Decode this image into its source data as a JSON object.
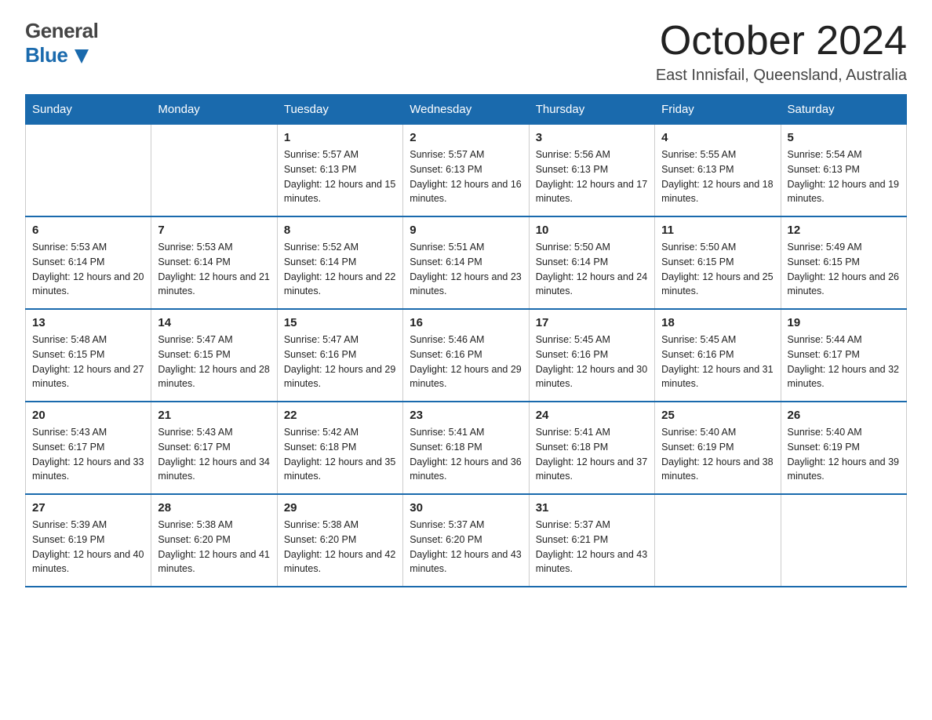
{
  "logo": {
    "general": "General",
    "blue": "Blue"
  },
  "header": {
    "month": "October 2024",
    "location": "East Innisfail, Queensland, Australia"
  },
  "weekdays": [
    "Sunday",
    "Monday",
    "Tuesday",
    "Wednesday",
    "Thursday",
    "Friday",
    "Saturday"
  ],
  "weeks": [
    [
      {
        "day": "",
        "sunrise": "",
        "sunset": "",
        "daylight": ""
      },
      {
        "day": "",
        "sunrise": "",
        "sunset": "",
        "daylight": ""
      },
      {
        "day": "1",
        "sunrise": "Sunrise: 5:57 AM",
        "sunset": "Sunset: 6:13 PM",
        "daylight": "Daylight: 12 hours and 15 minutes."
      },
      {
        "day": "2",
        "sunrise": "Sunrise: 5:57 AM",
        "sunset": "Sunset: 6:13 PM",
        "daylight": "Daylight: 12 hours and 16 minutes."
      },
      {
        "day": "3",
        "sunrise": "Sunrise: 5:56 AM",
        "sunset": "Sunset: 6:13 PM",
        "daylight": "Daylight: 12 hours and 17 minutes."
      },
      {
        "day": "4",
        "sunrise": "Sunrise: 5:55 AM",
        "sunset": "Sunset: 6:13 PM",
        "daylight": "Daylight: 12 hours and 18 minutes."
      },
      {
        "day": "5",
        "sunrise": "Sunrise: 5:54 AM",
        "sunset": "Sunset: 6:13 PM",
        "daylight": "Daylight: 12 hours and 19 minutes."
      }
    ],
    [
      {
        "day": "6",
        "sunrise": "Sunrise: 5:53 AM",
        "sunset": "Sunset: 6:14 PM",
        "daylight": "Daylight: 12 hours and 20 minutes."
      },
      {
        "day": "7",
        "sunrise": "Sunrise: 5:53 AM",
        "sunset": "Sunset: 6:14 PM",
        "daylight": "Daylight: 12 hours and 21 minutes."
      },
      {
        "day": "8",
        "sunrise": "Sunrise: 5:52 AM",
        "sunset": "Sunset: 6:14 PM",
        "daylight": "Daylight: 12 hours and 22 minutes."
      },
      {
        "day": "9",
        "sunrise": "Sunrise: 5:51 AM",
        "sunset": "Sunset: 6:14 PM",
        "daylight": "Daylight: 12 hours and 23 minutes."
      },
      {
        "day": "10",
        "sunrise": "Sunrise: 5:50 AM",
        "sunset": "Sunset: 6:14 PM",
        "daylight": "Daylight: 12 hours and 24 minutes."
      },
      {
        "day": "11",
        "sunrise": "Sunrise: 5:50 AM",
        "sunset": "Sunset: 6:15 PM",
        "daylight": "Daylight: 12 hours and 25 minutes."
      },
      {
        "day": "12",
        "sunrise": "Sunrise: 5:49 AM",
        "sunset": "Sunset: 6:15 PM",
        "daylight": "Daylight: 12 hours and 26 minutes."
      }
    ],
    [
      {
        "day": "13",
        "sunrise": "Sunrise: 5:48 AM",
        "sunset": "Sunset: 6:15 PM",
        "daylight": "Daylight: 12 hours and 27 minutes."
      },
      {
        "day": "14",
        "sunrise": "Sunrise: 5:47 AM",
        "sunset": "Sunset: 6:15 PM",
        "daylight": "Daylight: 12 hours and 28 minutes."
      },
      {
        "day": "15",
        "sunrise": "Sunrise: 5:47 AM",
        "sunset": "Sunset: 6:16 PM",
        "daylight": "Daylight: 12 hours and 29 minutes."
      },
      {
        "day": "16",
        "sunrise": "Sunrise: 5:46 AM",
        "sunset": "Sunset: 6:16 PM",
        "daylight": "Daylight: 12 hours and 29 minutes."
      },
      {
        "day": "17",
        "sunrise": "Sunrise: 5:45 AM",
        "sunset": "Sunset: 6:16 PM",
        "daylight": "Daylight: 12 hours and 30 minutes."
      },
      {
        "day": "18",
        "sunrise": "Sunrise: 5:45 AM",
        "sunset": "Sunset: 6:16 PM",
        "daylight": "Daylight: 12 hours and 31 minutes."
      },
      {
        "day": "19",
        "sunrise": "Sunrise: 5:44 AM",
        "sunset": "Sunset: 6:17 PM",
        "daylight": "Daylight: 12 hours and 32 minutes."
      }
    ],
    [
      {
        "day": "20",
        "sunrise": "Sunrise: 5:43 AM",
        "sunset": "Sunset: 6:17 PM",
        "daylight": "Daylight: 12 hours and 33 minutes."
      },
      {
        "day": "21",
        "sunrise": "Sunrise: 5:43 AM",
        "sunset": "Sunset: 6:17 PM",
        "daylight": "Daylight: 12 hours and 34 minutes."
      },
      {
        "day": "22",
        "sunrise": "Sunrise: 5:42 AM",
        "sunset": "Sunset: 6:18 PM",
        "daylight": "Daylight: 12 hours and 35 minutes."
      },
      {
        "day": "23",
        "sunrise": "Sunrise: 5:41 AM",
        "sunset": "Sunset: 6:18 PM",
        "daylight": "Daylight: 12 hours and 36 minutes."
      },
      {
        "day": "24",
        "sunrise": "Sunrise: 5:41 AM",
        "sunset": "Sunset: 6:18 PM",
        "daylight": "Daylight: 12 hours and 37 minutes."
      },
      {
        "day": "25",
        "sunrise": "Sunrise: 5:40 AM",
        "sunset": "Sunset: 6:19 PM",
        "daylight": "Daylight: 12 hours and 38 minutes."
      },
      {
        "day": "26",
        "sunrise": "Sunrise: 5:40 AM",
        "sunset": "Sunset: 6:19 PM",
        "daylight": "Daylight: 12 hours and 39 minutes."
      }
    ],
    [
      {
        "day": "27",
        "sunrise": "Sunrise: 5:39 AM",
        "sunset": "Sunset: 6:19 PM",
        "daylight": "Daylight: 12 hours and 40 minutes."
      },
      {
        "day": "28",
        "sunrise": "Sunrise: 5:38 AM",
        "sunset": "Sunset: 6:20 PM",
        "daylight": "Daylight: 12 hours and 41 minutes."
      },
      {
        "day": "29",
        "sunrise": "Sunrise: 5:38 AM",
        "sunset": "Sunset: 6:20 PM",
        "daylight": "Daylight: 12 hours and 42 minutes."
      },
      {
        "day": "30",
        "sunrise": "Sunrise: 5:37 AM",
        "sunset": "Sunset: 6:20 PM",
        "daylight": "Daylight: 12 hours and 43 minutes."
      },
      {
        "day": "31",
        "sunrise": "Sunrise: 5:37 AM",
        "sunset": "Sunset: 6:21 PM",
        "daylight": "Daylight: 12 hours and 43 minutes."
      },
      {
        "day": "",
        "sunrise": "",
        "sunset": "",
        "daylight": ""
      },
      {
        "day": "",
        "sunrise": "",
        "sunset": "",
        "daylight": ""
      }
    ]
  ]
}
